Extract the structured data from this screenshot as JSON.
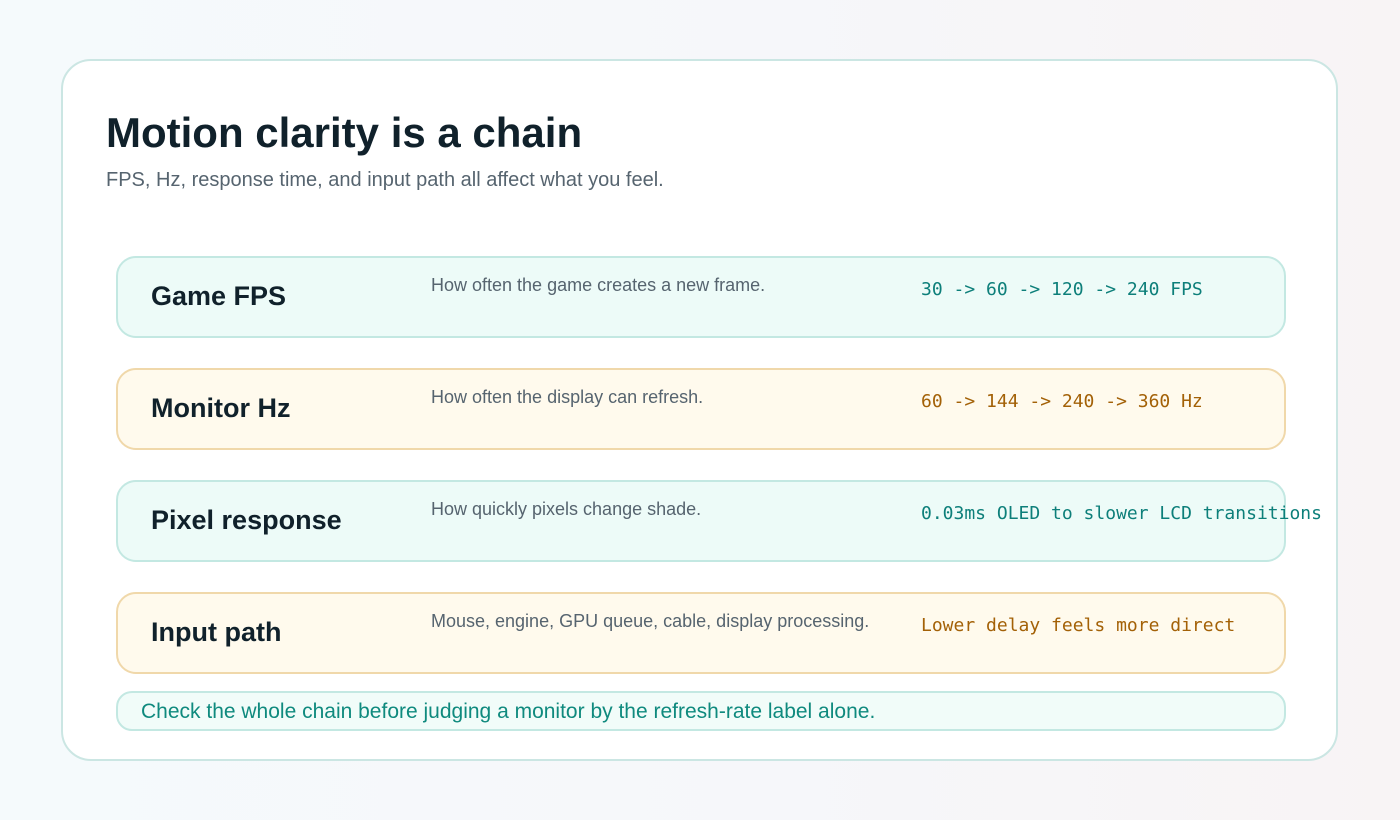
{
  "header": {
    "title": "Motion clarity is a chain",
    "subtitle": "FPS, Hz, response time, and input path all affect what you feel."
  },
  "rows": [
    {
      "name": "Game FPS",
      "description": "How often the game creates a new frame.",
      "value": "30 -> 60 -> 120 -> 240 FPS",
      "tone": "teal"
    },
    {
      "name": "Monitor Hz",
      "description": "How often the display can refresh.",
      "value": "60 -> 144 -> 240 -> 360 Hz",
      "tone": "amber"
    },
    {
      "name": "Pixel response",
      "description": "How quickly pixels change shade.",
      "value": "0.03ms OLED to slower LCD transitions",
      "tone": "teal"
    },
    {
      "name": "Input path",
      "description": "Mouse, engine, GPU queue, cable, display processing.",
      "value": "Lower delay feels more direct",
      "tone": "amber"
    }
  ],
  "footer": {
    "note": "Check the whole chain before judging a monitor by the refresh-rate label alone."
  },
  "colors": {
    "teal_accent": "#0d7f7a",
    "amber_accent": "#a36107",
    "title_text": "#10212b",
    "muted_text": "#56646f",
    "note_text": "#0f8a7e"
  }
}
